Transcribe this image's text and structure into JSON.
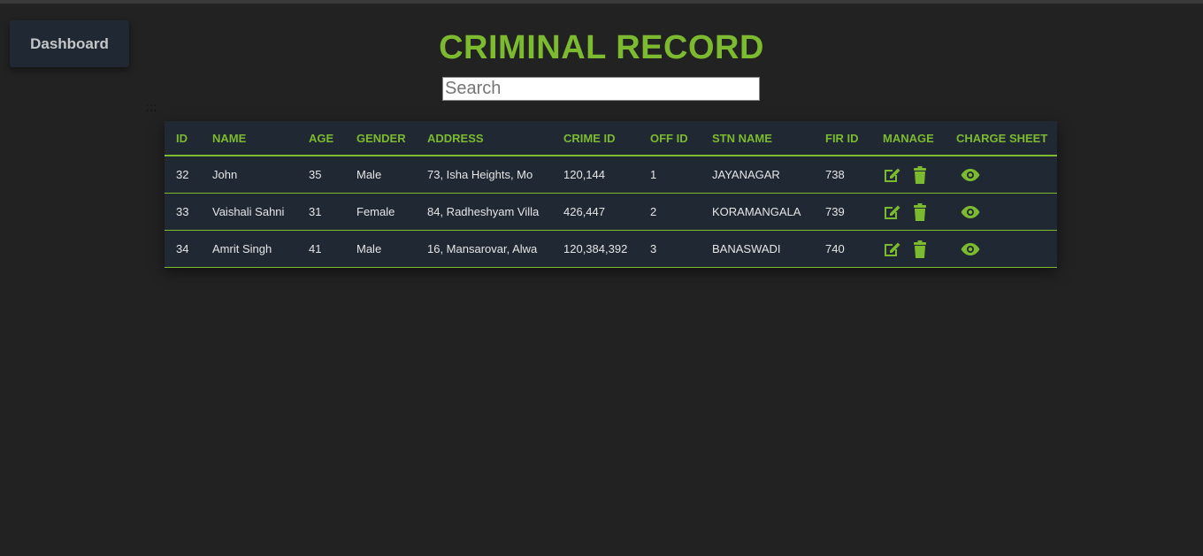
{
  "nav": {
    "dashboard_label": "Dashboard"
  },
  "page": {
    "title": "CRIMINAL RECORD",
    "search_placeholder": "Search",
    "stray_text": ";;;"
  },
  "table": {
    "headers": [
      "ID",
      "NAME",
      "AGE",
      "GENDER",
      "ADDRESS",
      "CRIME ID",
      "OFF ID",
      "STN NAME",
      "FIR ID",
      "MANAGE",
      "CHARGE SHEET"
    ],
    "rows": [
      {
        "id": "32",
        "name": "John",
        "age": "35",
        "gender": "Male",
        "address": "73, Isha Heights, Mo",
        "crime_id": "120,144",
        "off_id": "1",
        "stn_name": "JAYANAGAR",
        "fir_id": "738"
      },
      {
        "id": "33",
        "name": "Vaishali Sahni",
        "age": "31",
        "gender": "Female",
        "address": "84, Radheshyam Villa",
        "crime_id": "426,447",
        "off_id": "2",
        "stn_name": "KORAMANGALA",
        "fir_id": "739"
      },
      {
        "id": "34",
        "name": "Amrit Singh",
        "age": "41",
        "gender": "Male",
        "address": "16, Mansarovar, Alwa",
        "crime_id": "120,384,392",
        "off_id": "3",
        "stn_name": "BANASWADI",
        "fir_id": "740"
      }
    ],
    "icons": {
      "edit": "edit-icon",
      "delete": "trash-icon",
      "view": "eye-icon"
    }
  },
  "colors": {
    "accent": "#7cba2f",
    "background": "#222222",
    "panel": "#1f2833",
    "text": "#e6e6e6"
  }
}
